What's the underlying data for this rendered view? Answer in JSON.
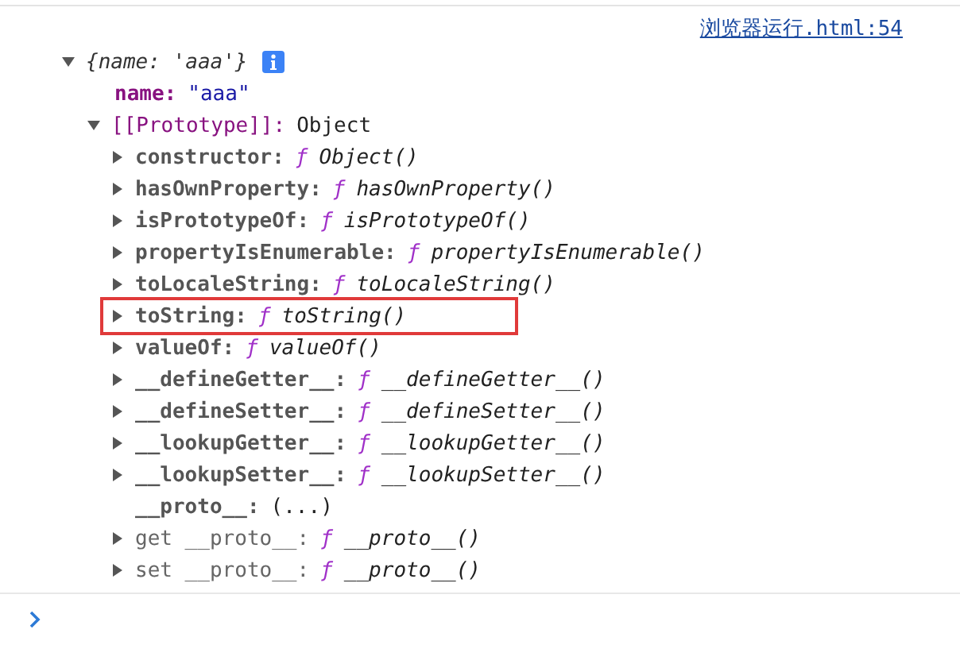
{
  "source_link": "浏览器运行.html:54",
  "object": {
    "summary": "{name: 'aaa'}",
    "expanded": true,
    "properties": [
      {
        "key": "name:",
        "value": "\"aaa\""
      }
    ],
    "prototype": {
      "label": "[[Prototype]]:",
      "value": "Object",
      "expanded": true,
      "members": [
        {
          "kind": "method",
          "key": "constructor:",
          "sign": "ƒ",
          "value": "Object()",
          "expandable": true,
          "highlighted": false
        },
        {
          "kind": "method",
          "key": "hasOwnProperty:",
          "sign": "ƒ",
          "value": "hasOwnProperty()",
          "expandable": true,
          "highlighted": false
        },
        {
          "kind": "method",
          "key": "isPrototypeOf:",
          "sign": "ƒ",
          "value": "isPrototypeOf()",
          "expandable": true,
          "highlighted": false
        },
        {
          "kind": "method",
          "key": "propertyIsEnumerable:",
          "sign": "ƒ",
          "value": "propertyIsEnumerable()",
          "expandable": true,
          "highlighted": false
        },
        {
          "kind": "method",
          "key": "toLocaleString:",
          "sign": "ƒ",
          "value": "toLocaleString()",
          "expandable": true,
          "highlighted": false
        },
        {
          "kind": "method",
          "key": "toString:",
          "sign": "ƒ",
          "value": "toString()",
          "expandable": true,
          "highlighted": true
        },
        {
          "kind": "method",
          "key": "valueOf:",
          "sign": "ƒ",
          "value": "valueOf()",
          "expandable": true,
          "highlighted": false
        },
        {
          "kind": "method",
          "key": "__defineGetter__:",
          "sign": "ƒ",
          "value": "__defineGetter__()",
          "expandable": true,
          "highlighted": false
        },
        {
          "kind": "method",
          "key": "__defineSetter__:",
          "sign": "ƒ",
          "value": "__defineSetter__()",
          "expandable": true,
          "highlighted": false
        },
        {
          "kind": "method",
          "key": "__lookupGetter__:",
          "sign": "ƒ",
          "value": "__lookupGetter__()",
          "expandable": true,
          "highlighted": false
        },
        {
          "kind": "method",
          "key": "__lookupSetter__:",
          "sign": "ƒ",
          "value": "__lookupSetter__()",
          "expandable": true,
          "highlighted": false
        },
        {
          "kind": "lazy",
          "key": "__proto__:",
          "value": "(...)",
          "expandable": false,
          "highlighted": false
        },
        {
          "kind": "accessor",
          "key": "get __proto__:",
          "sign": "ƒ",
          "value": "__proto__()",
          "expandable": true,
          "highlighted": false
        },
        {
          "kind": "accessor",
          "key": "set __proto__:",
          "sign": "ƒ",
          "value": "__proto__()",
          "expandable": true,
          "highlighted": false
        }
      ]
    }
  }
}
